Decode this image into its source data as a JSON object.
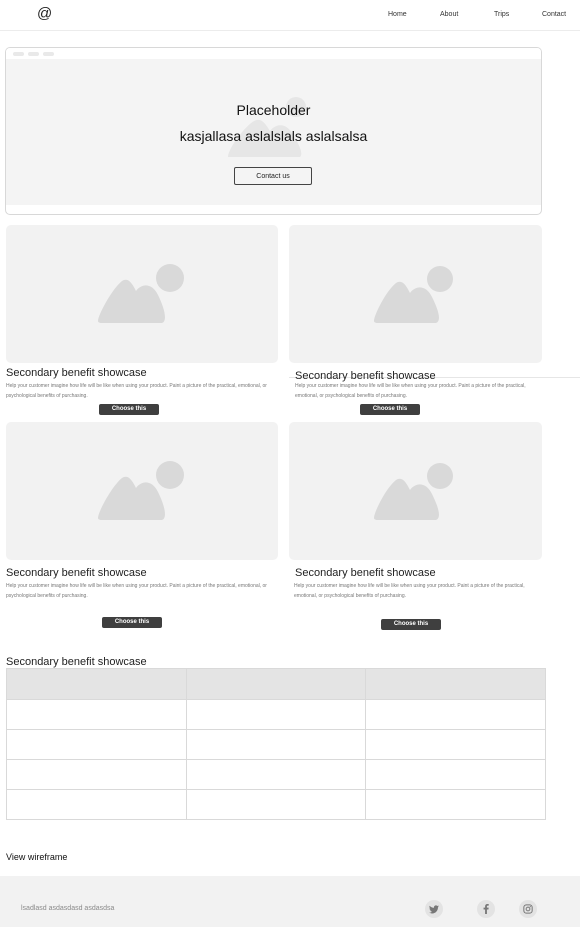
{
  "nav": {
    "logo": "@",
    "links": [
      "Home",
      "About",
      "Trips",
      "Contact"
    ]
  },
  "hero": {
    "title": "Placeholder",
    "subtitle": "kasjallasa aslalslals aslalsalsa",
    "button": "Contact us"
  },
  "cards": [
    {
      "title": "Secondary benefit showcase",
      "desc": "Help your customer imagine how life will be like when using your product. Paint a picture of the practical, emotional, or psychological benefits of purchasing.",
      "button": "Choose this"
    },
    {
      "title": "Secondary benefit showcase",
      "desc": "Help your customer imagine how life will be like when using your product. Paint a picture of the practical, emotional, or psychological benefits of purchasing.",
      "button": "Choose this"
    },
    {
      "title": "Secondary benefit showcase",
      "desc": "Help your customer imagine how life will be like when using your product. Paint a picture of the practical, emotional, or psychological benefits of purchasing.",
      "button": "Choose this"
    },
    {
      "title": "Secondary benefit showcase",
      "desc": "Help your customer imagine how life will be like when using your product. Paint a picture of the practical, emotional, or psychological benefits of purchasing.",
      "button": "Choose this"
    }
  ],
  "table": {
    "title": "Secondary benefit showcase"
  },
  "view_link": "View wireframe",
  "footer": {
    "text": "lsadlasd asdasdasd asdasdsa",
    "social_icons": [
      "twitter-icon",
      "facebook-icon",
      "instagram-icon"
    ]
  },
  "colors": {
    "placeholder_bg": "#f2f2f2",
    "placeholder_icon": "#dadada",
    "button_dark": "#3f3f3f",
    "table_header": "#e4e4e4"
  }
}
